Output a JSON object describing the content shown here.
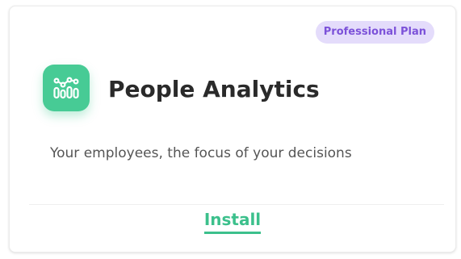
{
  "card": {
    "badge": "Professional Plan",
    "icon": "people-analytics-icon",
    "title": "People Analytics",
    "description": "Your employees, the focus of your decisions",
    "install_label": "Install"
  },
  "colors": {
    "accent_green": "#47cb95",
    "badge_bg": "#e4dcfb",
    "badge_text": "#7c52d9",
    "title_text": "#2a2a2a",
    "description_text": "#555555"
  }
}
